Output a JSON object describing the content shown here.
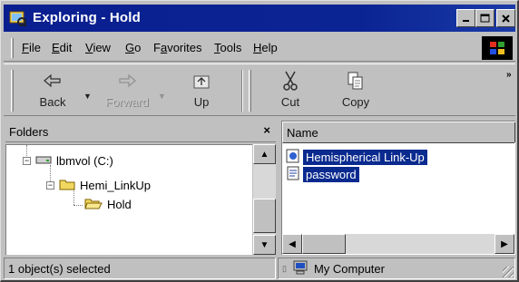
{
  "window": {
    "title": "Exploring - Hold"
  },
  "menu": [
    {
      "pre": "",
      "ul": "F",
      "post": "ile"
    },
    {
      "pre": "",
      "ul": "E",
      "post": "dit"
    },
    {
      "pre": "",
      "ul": "V",
      "post": "iew"
    },
    {
      "pre": "",
      "ul": "G",
      "post": "o"
    },
    {
      "pre": "F",
      "ul": "a",
      "post": "vorites"
    },
    {
      "pre": "",
      "ul": "T",
      "post": "ools"
    },
    {
      "pre": "",
      "ul": "H",
      "post": "elp"
    }
  ],
  "toolbar": {
    "back": "Back",
    "forward": "Forward",
    "up": "Up",
    "cut": "Cut",
    "copy": "Copy",
    "more": "»"
  },
  "folders": {
    "header": "Folders",
    "close": "×",
    "tree": {
      "drive": "lbmvol (C:)",
      "folder1": "Hemi_LinkUp",
      "folder2": "Hold"
    }
  },
  "files": {
    "column_name": "Name",
    "items": [
      "Hemispherical Link-Up",
      "password"
    ]
  },
  "status": {
    "left": "1 object(s) selected",
    "zone": "My Computer"
  },
  "colors": {
    "title_bar": "#0a1f8f",
    "selection": "#0a2a8f",
    "face": "#c0c0c0"
  }
}
